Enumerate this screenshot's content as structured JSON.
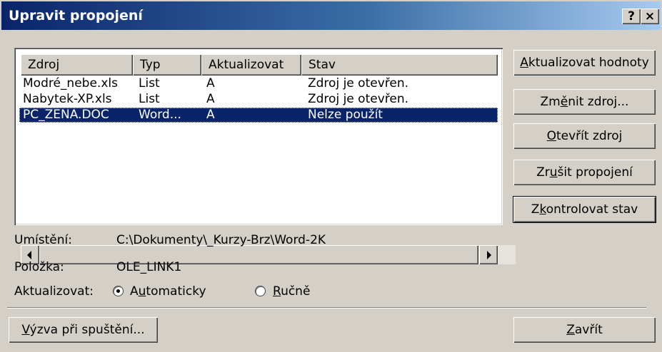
{
  "window": {
    "title": "Upravit propojení",
    "help_glyph": "?",
    "close_glyph": "×"
  },
  "list": {
    "columns": [
      "Zdroj",
      "Typ",
      "Aktualizovat",
      "Stav"
    ],
    "rows": [
      {
        "zdroj": "Modré_nebe.xls",
        "typ": "List",
        "aktualizovat": "A",
        "stav": "Zdroj je otevřen.",
        "selected": false
      },
      {
        "zdroj": "Nabytek-XP.xls",
        "typ": "List",
        "aktualizovat": "A",
        "stav": "Zdroj je otevřen.",
        "selected": false
      },
      {
        "zdroj": "PC_ZENA.DOC",
        "typ": "Word...",
        "aktualizovat": "A",
        "stav": "Nelze použít",
        "selected": true
      }
    ]
  },
  "buttons": {
    "update_values": {
      "pre": "",
      "key": "A",
      "post": "ktualizovat hodnoty"
    },
    "change_source": {
      "pre": "Zm",
      "key": "ě",
      "post": "nit zdroj..."
    },
    "open_source": {
      "pre": "",
      "key": "O",
      "post": "tevřít zdroj"
    },
    "break_link": {
      "pre": "Zr",
      "key": "u",
      "post": "šit propojení"
    },
    "check_status": {
      "pre": "Z",
      "key": "k",
      "post": "ontrolovat stav"
    },
    "startup_prompt": {
      "pre": "",
      "key": "V",
      "post": "ýzva při spuštění..."
    },
    "close": {
      "pre": "",
      "key": "Z",
      "post": "avřít"
    }
  },
  "details": {
    "location_label": "Umístění:",
    "location_value": "C:\\Dokumenty\\_Kurzy-Brz\\Word-2K",
    "item_label": "Položka:",
    "item_value": "OLE_LINK1",
    "update_label": "Aktualizovat:",
    "auto": {
      "pre": "A",
      "key": "u",
      "post": "tomaticky",
      "checked": true
    },
    "manual": {
      "pre": "",
      "key": "R",
      "post": "učně",
      "checked": false
    }
  }
}
